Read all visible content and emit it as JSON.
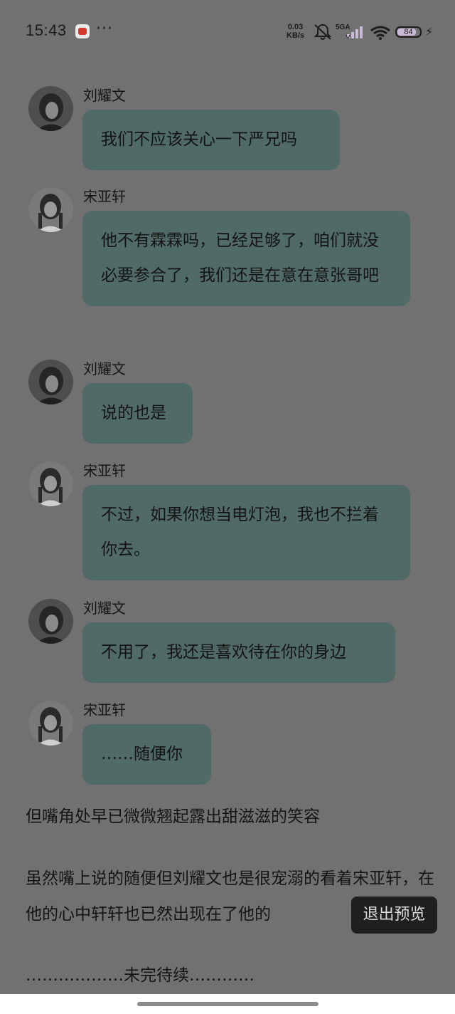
{
  "status_bar": {
    "time": "15:43",
    "more": "···",
    "speed_value": "0.03",
    "speed_unit": "KB/s",
    "network": "5GA",
    "battery": "84"
  },
  "messages": [
    {
      "sender": "刘耀文",
      "text": "我们不应该关心一下严兄吗"
    },
    {
      "sender": "宋亚轩",
      "text": "他不有霖霖吗，已经足够了，咱们就没必要参合了，我们还是在意在意张哥吧"
    },
    {
      "sender": "刘耀文",
      "text": "说的也是"
    },
    {
      "sender": "宋亚轩",
      "text": "不过，如果你想当电灯泡，我也不拦着你去。"
    },
    {
      "sender": "刘耀文",
      "text": "不用了，我还是喜欢待在你的身边"
    },
    {
      "sender": "宋亚轩",
      "text": "……随便你"
    }
  ],
  "narration": [
    "但嘴角处早已微微翘起露出甜滋滋的笑容",
    "虽然嘴上说的随便但刘耀文也是很宠溺的看着宋亚轩，在他的心中轩轩也已然出现在了他的",
    "………………未完待续…………"
  ],
  "exit_preview_label": "退出预览",
  "colors": {
    "background": "#717171",
    "bubble": "#506b67",
    "exit_button": "#1f1f1f"
  }
}
